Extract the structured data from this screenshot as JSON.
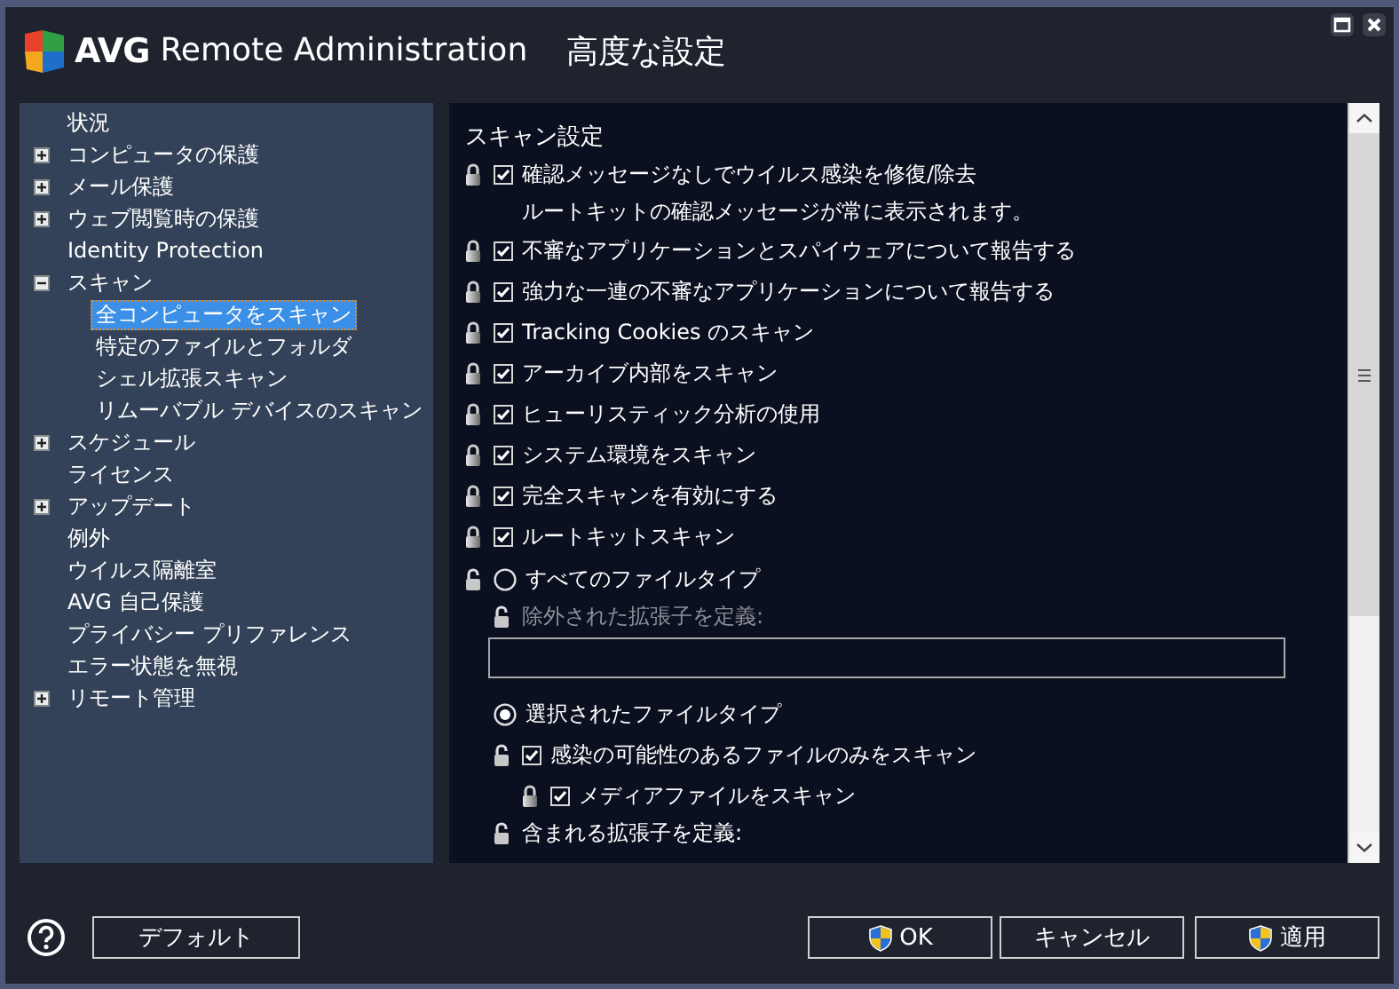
{
  "window": {
    "brand": "AVG",
    "product": "Remote Administration",
    "title": "高度な設定"
  },
  "tree": [
    {
      "label": "状況",
      "selected": false
    },
    {
      "label": "コンピュータの保護",
      "expanded": false,
      "selected": false
    },
    {
      "label": "メール保護",
      "expanded": false,
      "selected": false
    },
    {
      "label": "ウェブ閲覧時の保護",
      "expanded": false,
      "selected": false
    },
    {
      "label": "Identity Protection",
      "selected": false
    },
    {
      "label": "スキャン",
      "expanded": true,
      "selected": false,
      "children": [
        {
          "label": "全コンピュータをスキャン",
          "selected": true
        },
        {
          "label": "特定のファイルとフォルダ",
          "selected": false
        },
        {
          "label": "シェル拡張スキャン",
          "selected": false
        },
        {
          "label": "リムーバブル デバイスのスキャン",
          "selected": false
        }
      ]
    },
    {
      "label": "スケジュール",
      "expanded": false,
      "selected": false
    },
    {
      "label": "ライセンス",
      "selected": false
    },
    {
      "label": "アップデート",
      "expanded": false,
      "selected": false
    },
    {
      "label": "例外",
      "selected": false
    },
    {
      "label": "ウイルス隔離室",
      "selected": false
    },
    {
      "label": "AVG 自己保護",
      "selected": false
    },
    {
      "label": "プライバシー プリファレンス",
      "selected": false
    },
    {
      "label": "エラー状態を無視",
      "selected": false
    },
    {
      "label": "リモート管理",
      "expanded": false,
      "selected": false
    }
  ],
  "scan_settings": {
    "heading": "スキャン設定",
    "options": [
      {
        "kind": "checkbox",
        "label": "確認メッセージなしでウイルス感染を修復/除去",
        "note": "ルートキットの確認メッセージが常に表示されます。",
        "checked": true,
        "locked": true
      },
      {
        "kind": "checkbox",
        "label": "不審なアプリケーションとスパイウェアについて報告する",
        "checked": true,
        "locked": true
      },
      {
        "kind": "checkbox",
        "label": "強力な一連の不審なアプリケーションについて報告する",
        "checked": true,
        "locked": true
      },
      {
        "kind": "checkbox",
        "label": "Tracking Cookies のスキャン",
        "checked": true,
        "locked": true
      },
      {
        "kind": "checkbox",
        "label": "アーカイブ内部をスキャン",
        "checked": true,
        "locked": true
      },
      {
        "kind": "checkbox",
        "label": "ヒューリスティック分析の使用",
        "checked": true,
        "locked": true
      },
      {
        "kind": "checkbox",
        "label": "システム環境をスキャン",
        "checked": true,
        "locked": true
      },
      {
        "kind": "checkbox",
        "label": "完全スキャンを有効にする",
        "checked": true,
        "locked": true
      },
      {
        "kind": "checkbox",
        "label": "ルートキットスキャン",
        "checked": true,
        "locked": true
      },
      {
        "kind": "radio",
        "label": "すべてのファイルタイプ",
        "selected": false,
        "locked": false,
        "children": [
          {
            "kind": "field_label",
            "label": "除外された拡張子を定義:",
            "disabled": true,
            "locked": false
          },
          {
            "kind": "field"
          }
        ]
      },
      {
        "kind": "radio",
        "label": "選択されたファイルタイプ",
        "selected": true,
        "children": [
          {
            "kind": "checkbox",
            "label": "感染の可能性のあるファイルのみをスキャン",
            "checked": true,
            "locked": false,
            "children": [
              {
                "kind": "checkbox",
                "label": "メディアファイルをスキャン",
                "checked": true,
                "locked": true
              }
            ]
          },
          {
            "kind": "field_label",
            "label": "含まれる拡張子を定義:",
            "disabled": false,
            "locked": false
          }
        ]
      }
    ]
  },
  "buttons": {
    "default": "デフォルト",
    "ok": "OK",
    "cancel": "キャンセル",
    "apply": "適用"
  }
}
